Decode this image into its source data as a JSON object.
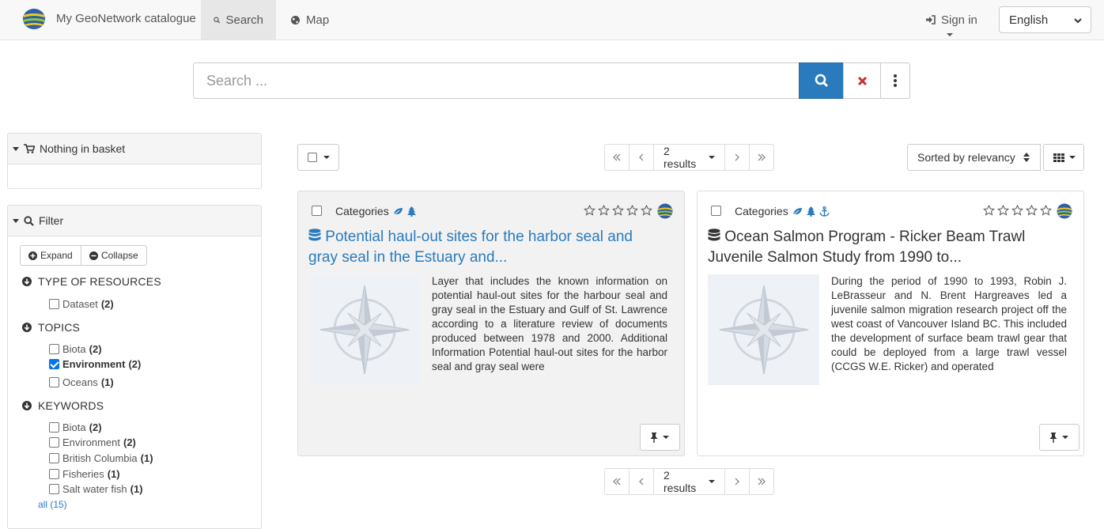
{
  "header": {
    "brand": "My GeoNetwork catalogue",
    "tabs": [
      {
        "label": "Search",
        "icon": "search-icon",
        "active": true
      },
      {
        "label": "Map",
        "icon": "globe-icon",
        "active": false
      }
    ],
    "signin_label": "Sign in",
    "language": "English"
  },
  "search": {
    "placeholder": "Search ..."
  },
  "sidebar": {
    "basket_label": "Nothing in basket",
    "filter_label": "Filter",
    "expand_label": "Expand",
    "collapse_label": "Collapse",
    "facets": [
      {
        "title": "TYPE OF RESOURCES",
        "items": [
          {
            "label": "Dataset",
            "count": "(2)",
            "checked": false
          }
        ]
      },
      {
        "title": "TOPICS",
        "items": [
          {
            "label": "Biota",
            "count": "(2)",
            "checked": false
          },
          {
            "label": "Environment",
            "count": "(2)",
            "checked": true
          },
          {
            "label": "Oceans",
            "count": "(1)",
            "checked": false
          }
        ]
      },
      {
        "title": "KEYWORDS",
        "items": [
          {
            "label": "Biota",
            "count": "(2)",
            "checked": false
          },
          {
            "label": "Environment",
            "count": "(2)",
            "checked": false
          },
          {
            "label": "British Columbia",
            "count": "(1)",
            "checked": false
          },
          {
            "label": "Fisheries",
            "count": "(1)",
            "checked": false
          },
          {
            "label": "Salt water fish",
            "count": "(1)",
            "checked": false
          }
        ]
      }
    ],
    "all_label": "all (15)"
  },
  "results": {
    "count_label": "2 results",
    "sort_label": "Sorted by relevancy",
    "categories_label": "Categories",
    "items": [
      {
        "title": "Potential haul-out sites for the harbor seal and gray seal in the Estuary and...",
        "description": "Layer that includes the known information on potential haul-out sites for the harbour seal and gray seal in the Estuary and Gulf of St. Lawrence according to a literature review of documents produced between 1978 and 2000. Additional Information Potential haul-out sites for the harbor seal and gray seal were",
        "category_icons": [
          "leaf-icon",
          "tree-icon"
        ],
        "title_color": "#2a7bbd"
      },
      {
        "title": "Ocean Salmon Program - Ricker Beam Trawl Juvenile Salmon Study from 1990 to...",
        "description": "During the period of 1990 to 1993, Robin J. LeBrasseur and N. Brent Hargreaves led a juvenile salmon migration research project off the west coast of Vancouver Island BC. This included the development of surface beam trawl gear that could be deployed from a large trawl vessel (CCGS W.E. Ricker) and operated",
        "category_icons": [
          "leaf-icon",
          "tree-icon",
          "anchor-icon"
        ],
        "title_color": "#333333"
      }
    ]
  },
  "colors": {
    "accent": "#2a7bbd",
    "clear": "#c9302c"
  }
}
